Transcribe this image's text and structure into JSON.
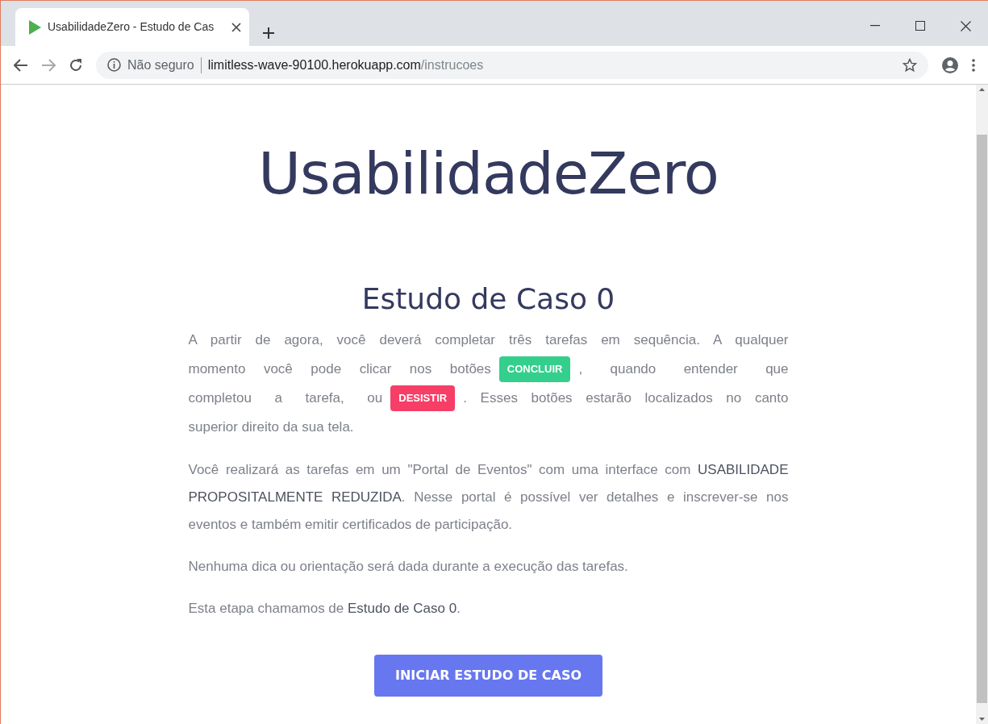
{
  "browser": {
    "tab_title": "UsabilidadeZero - Estudo de Cas",
    "url_security": "Não seguro",
    "url_host": "limitless-wave-90100.herokuapp.com",
    "url_path": "/instrucoes"
  },
  "page": {
    "logo": "UsabilidadeZero",
    "heading": "Estudo de Caso 0",
    "intro": [
      [
        {
          "kind": "text",
          "text": "A partir de agora, você deverá completar três tarefas em sequência. A qualquer"
        }
      ],
      [
        {
          "kind": "text",
          "text": "momento você pode clicar nos botões"
        },
        {
          "kind": "badge",
          "text": "CONCLUIR",
          "color": "#34cf8c"
        },
        {
          "kind": "text",
          "text": ", quando entender que"
        }
      ],
      [
        {
          "kind": "text",
          "text": "completou a tarefa, ou"
        },
        {
          "kind": "badge",
          "text": "DESISTIR",
          "color": "#f63e66"
        },
        {
          "kind": "text",
          "text": ". Esses botões estarão localizados no canto"
        }
      ],
      [
        {
          "kind": "text",
          "text": "superior direito da sua tela."
        }
      ]
    ],
    "paragraphs": [
      "Você realizará as tarefas em um \"Portal de Eventos\" com uma interface com **USABILIDADE PROPOSITALMENTE REDUZIDA**. Nesse portal é possível ver detalhes e inscrever-se nos eventos e também emitir certificados de participação.",
      "Nenhuma dica ou orientação será dada durante a execução das tarefas.",
      "Esta etapa chamamos de **Estudo de Caso 0**."
    ],
    "button": "INICIAR ESTUDO DE CASO"
  }
}
